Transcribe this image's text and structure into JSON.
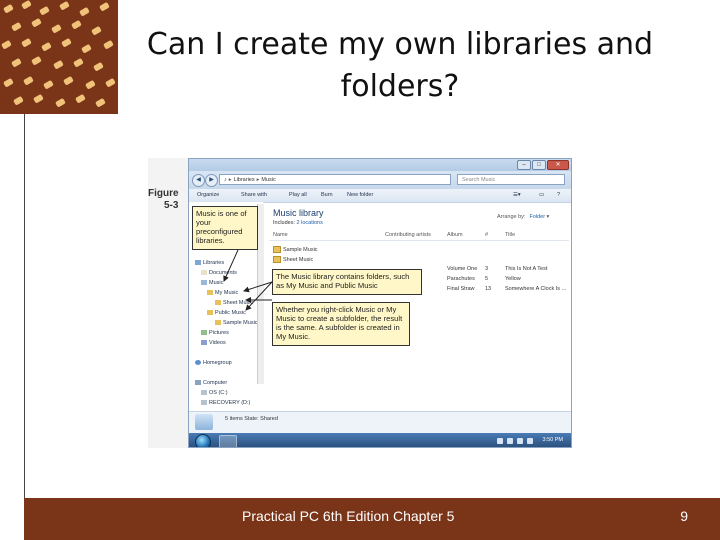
{
  "slide": {
    "title_line1": "Can I create my own libraries and",
    "title_line2": "folders?",
    "footer": "Practical PC 6th Edition Chapter 5",
    "page_number": "9",
    "accent_color": "#7a3418"
  },
  "figure": {
    "label_line1": "Figure",
    "label_line2": "5-3"
  },
  "explorer": {
    "address": [
      "Libraries",
      "Music"
    ],
    "search_placeholder": "Search Music",
    "toolbar": [
      "Organize",
      "Share with",
      "Play all",
      "Burn",
      "New folder"
    ],
    "nav_items": [
      {
        "label": "Libraries",
        "icon": "library-icon"
      },
      {
        "label": "Documents",
        "icon": "documents-icon"
      },
      {
        "label": "Music",
        "icon": "music-icon"
      },
      {
        "label": "My Music",
        "icon": "folder-icon"
      },
      {
        "label": "Sheet Music",
        "icon": "folder-icon"
      },
      {
        "label": "Public Music",
        "icon": "folder-icon"
      },
      {
        "label": "Sample Music",
        "icon": "folder-icon"
      },
      {
        "label": "Pictures",
        "icon": "pictures-icon"
      },
      {
        "label": "Videos",
        "icon": "videos-icon"
      },
      {
        "label": "Homegroup",
        "icon": "homegroup-icon"
      },
      {
        "label": "Computer",
        "icon": "computer-icon"
      },
      {
        "label": "OS (C:)",
        "icon": "drive-icon"
      },
      {
        "label": "RECOVERY (D:)",
        "icon": "drive-icon"
      }
    ],
    "library_title": "Music library",
    "library_includes_prefix": "Includes:",
    "library_includes_link": "2 locations",
    "arrange_by_label": "Arrange by:",
    "arrange_by_value": "Folder",
    "columns": [
      "Name",
      "Contributing artists",
      "Album",
      "#",
      "Title"
    ],
    "folders": [
      "Sample Music",
      "Sheet Music"
    ],
    "rows": [
      {
        "album": "Volume One",
        "num": "3",
        "title": "This Is Not A Test"
      },
      {
        "album": "Parachutes",
        "num": "5",
        "title": "Yellow"
      },
      {
        "album": "Final Straw",
        "num": "13",
        "title": "Somewhere A Clock Is ..."
      }
    ],
    "status": "5 items  State:  Shared",
    "clock": "3:50 PM"
  },
  "callouts": {
    "music_library": "Music is one of your preconfigured libraries.",
    "contains_folders": "The Music library contains folders, such as My Music and Public Music",
    "subfolder": "Whether you right-click Music or My Music to create a subfolder, the result is the same. A subfolder is created in My Music."
  }
}
